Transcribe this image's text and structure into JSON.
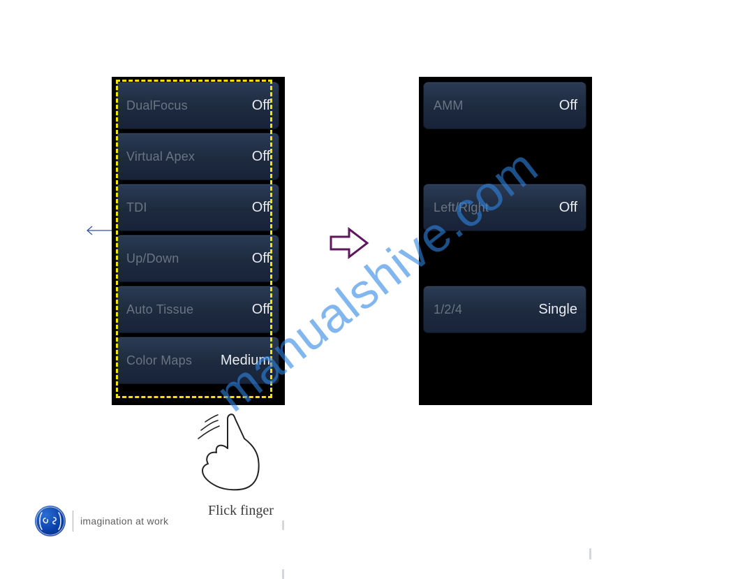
{
  "watermark_text": "manualshive.com",
  "left_panel": [
    {
      "label": "DualFocus",
      "value": "Off"
    },
    {
      "label": "Virtual Apex",
      "value": "Off"
    },
    {
      "label": "TDI",
      "value": "Off"
    },
    {
      "label": "Up/Down",
      "value": "Off"
    },
    {
      "label": "Auto Tissue",
      "value": "Off"
    },
    {
      "label": "Color Maps",
      "value": "Medium"
    }
  ],
  "right_panel": [
    {
      "label": "AMM",
      "value": "Off"
    },
    {
      "label": "",
      "value": ""
    },
    {
      "label": "Left/Right",
      "value": "Off"
    },
    {
      "label": "",
      "value": ""
    },
    {
      "label": "1/2/4",
      "value": "Single"
    },
    {
      "label": "",
      "value": ""
    }
  ],
  "gesture_caption": "Flick finger",
  "footer_tagline": "imagination at work"
}
